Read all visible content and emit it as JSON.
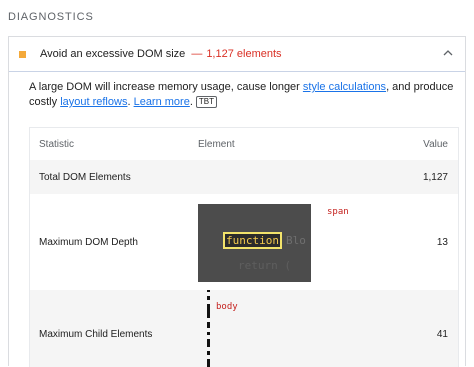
{
  "section": {
    "title": "DIAGNOSTICS"
  },
  "audit": {
    "status_color": "#f4a93a",
    "title": "Avoid an excessive DOM size",
    "separator": "—",
    "display_value": "1,127 elements",
    "expanded_icon": "chevron-up-icon",
    "description": {
      "text_before": "A large DOM will increase memory usage, cause longer ",
      "link1": "style calculations",
      "text_middle": ", and produce costly ",
      "link2": "layout reflows",
      "text_after": ". ",
      "link3": "Learn more",
      "text_end": ".",
      "tag": "TBT"
    },
    "table": {
      "headers": {
        "statistic": "Statistic",
        "element": "Element",
        "value": "Value"
      },
      "rows": [
        {
          "statistic": "Total DOM Elements",
          "element": "",
          "value": "1,127"
        },
        {
          "statistic": "Maximum DOM Depth",
          "element_label": "span",
          "snippet_keyword": "function",
          "snippet_faded": "Blo",
          "snippet_line2": "return (",
          "value": "13"
        },
        {
          "statistic": "Maximum Child Elements",
          "element_label": "body",
          "value": "41"
        }
      ]
    }
  }
}
